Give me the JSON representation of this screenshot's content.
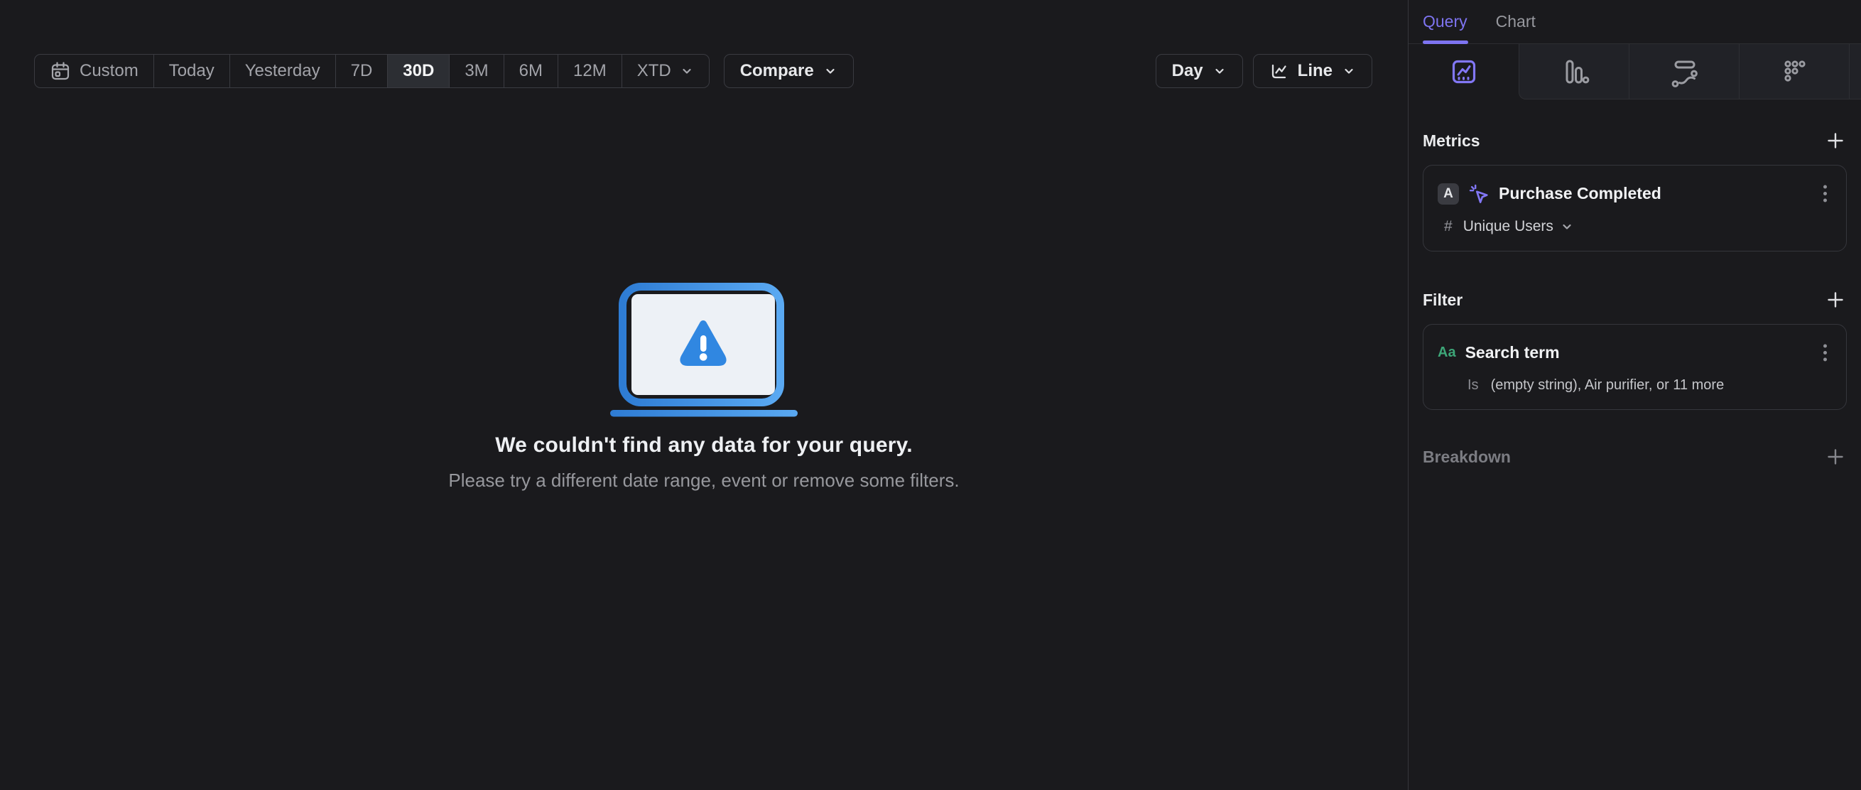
{
  "colors": {
    "accent_purple": "#7E74F1",
    "filter_green": "#3DA678",
    "illustration_blue_dark": "#2E7CD4",
    "illustration_blue_light": "#5AA9F2",
    "warning_triangle_blue": "#3087E1",
    "background_dark": "#1A1A1D"
  },
  "toolbar": {
    "date_buttons": [
      "Custom",
      "Today",
      "Yesterday",
      "7D",
      "30D",
      "3M",
      "6M",
      "12M",
      "XTD"
    ],
    "selected_range": "30D",
    "compare_label": "Compare",
    "granularity_label": "Day",
    "chart_type_label": "Line",
    "icons": [
      "calendar-icon",
      "chevron-down-icon",
      "line-chart-icon"
    ]
  },
  "empty_state": {
    "icon": "laptop-warning-illustration",
    "title": "We couldn't find any data for your query.",
    "subtitle": "Please try a different date range, event or remove some filters."
  },
  "sidebar": {
    "tabs": [
      {
        "label": "Query",
        "active": true
      },
      {
        "label": "Chart",
        "active": false
      }
    ],
    "view_tabs": [
      {
        "icon": "insights-line-chart-icon",
        "active": true
      },
      {
        "icon": "bar-chart-icon",
        "active": false
      },
      {
        "icon": "flow-icon",
        "active": false
      },
      {
        "icon": "metric-dots-icon",
        "active": false
      }
    ],
    "metrics": {
      "heading": "Metrics",
      "add_icon": "plus-icon",
      "items": [
        {
          "letter": "A",
          "event_icon": "cursor-click-icon",
          "event_name": "Purchase Completed",
          "aggregation_prefix": "#",
          "aggregation": "Unique Users",
          "menu_icon": "kebab-menu-icon"
        }
      ]
    },
    "filter": {
      "heading": "Filter",
      "add_icon": "plus-icon",
      "items": [
        {
          "property_type": "Aa",
          "property_name": "Search term",
          "operator": "Is",
          "values_summary": "(empty string), Air purifier, or 11 more",
          "menu_icon": "kebab-menu-icon"
        }
      ]
    },
    "breakdown": {
      "heading": "Breakdown",
      "add_icon": "plus-icon"
    }
  }
}
